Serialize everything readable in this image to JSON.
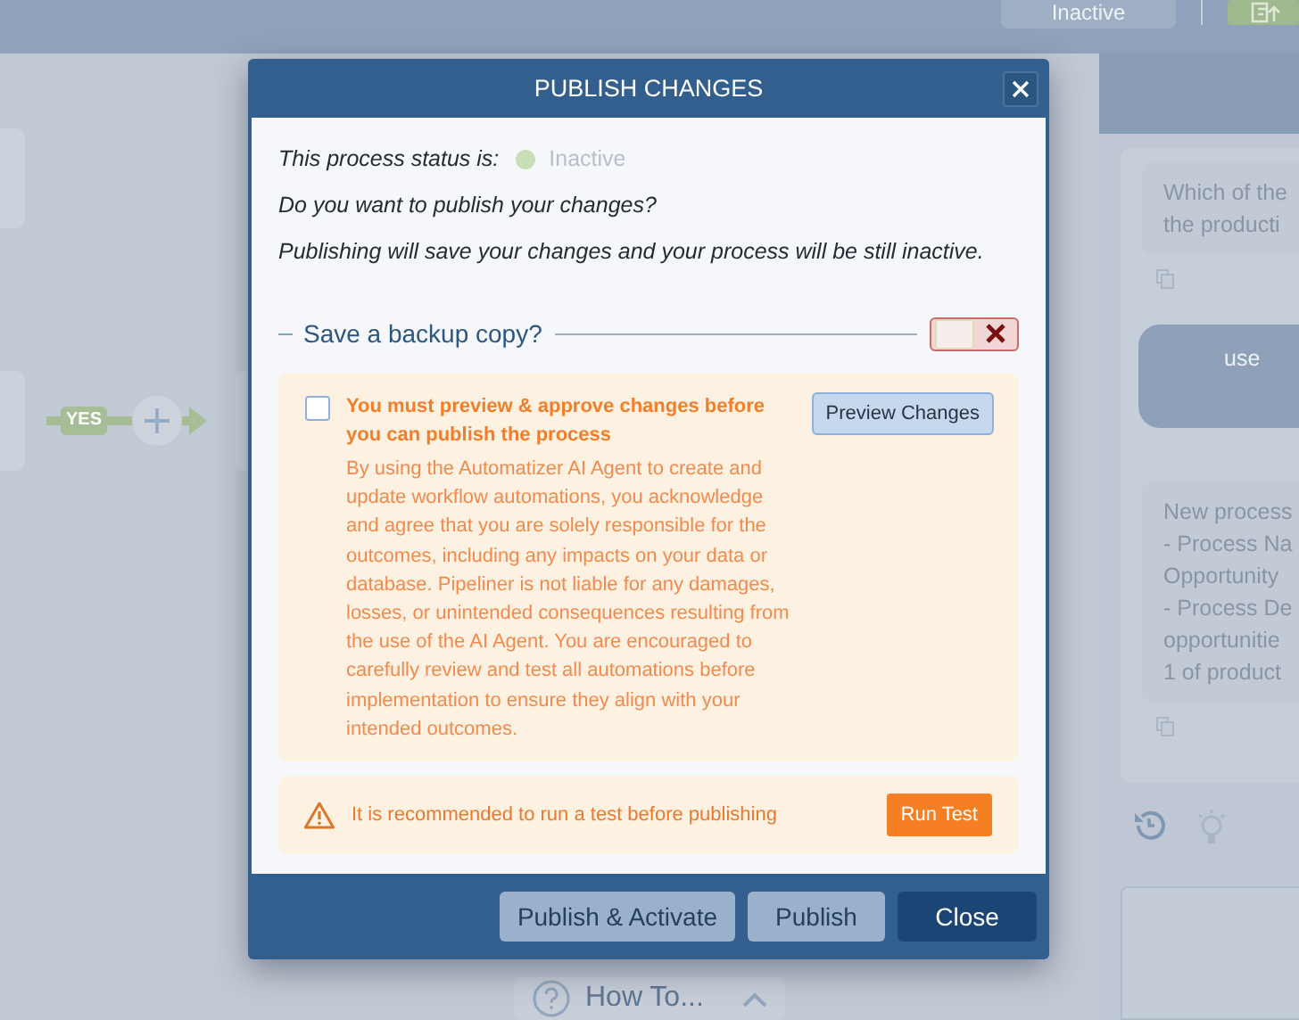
{
  "top_bar": {
    "status_button": "Inactive"
  },
  "canvas": {
    "connector_label": "YES",
    "help_button": "How To..."
  },
  "chat": {
    "messages": [
      {
        "kind": "assistant",
        "lines": [
          "Which of the",
          "the producti"
        ]
      },
      {
        "kind": "user",
        "lines": [
          "use"
        ]
      },
      {
        "kind": "assistant",
        "lines": [
          "New process",
          "- Process Na",
          "Opportunity",
          "- Process De",
          "opportunitie",
          "1 of product"
        ]
      }
    ]
  },
  "dialog": {
    "title": "PUBLISH CHANGES",
    "status_label": "This process status is:",
    "status": {
      "text": "Inactive",
      "color": "#c9ddb6"
    },
    "question": "Do you want to publish your changes?",
    "info": "Publishing will save your changes and your process will be still inactive.",
    "backup": {
      "label": "Save a backup copy?",
      "on": false
    },
    "approval": {
      "checked": false,
      "title": "You must preview & approve changes before you can publish the process",
      "notice": "By using the Automatizer AI Agent to create and update workflow automations, you acknowledge and agree that you are solely responsible for the outcomes, including any impacts on your data or database. Pipeliner is not liable for any damages, losses, or unintended consequences resulting from the use of the AI Agent. You are encouraged to carefully review and test all automations before implementation to ensure they align with your intended outcomes.",
      "button": "Preview Changes"
    },
    "test": {
      "text": "It is recommended to run a test before publishing",
      "button": "Run Test"
    },
    "buttons": [
      {
        "label": "Publish & Activate",
        "kind": "secondary"
      },
      {
        "label": "Publish",
        "kind": "secondary"
      },
      {
        "label": "Close",
        "kind": "primary"
      }
    ]
  }
}
